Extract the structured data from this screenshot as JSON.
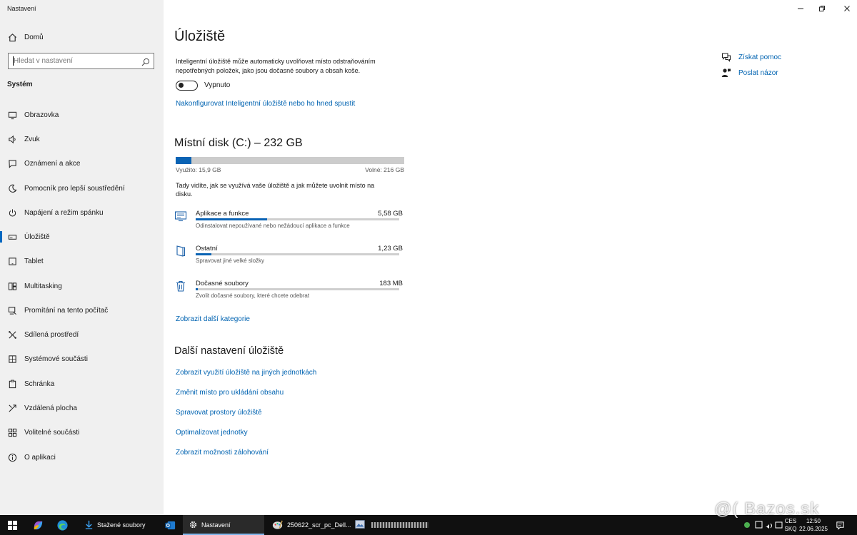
{
  "window": {
    "title": "Nastavení"
  },
  "sidebar": {
    "home_label": "Domů",
    "search_placeholder": "Hledat v nastavení",
    "section_label": "Systém",
    "items": [
      {
        "label": "Obrazovka",
        "icon": "monitor-icon"
      },
      {
        "label": "Zvuk",
        "icon": "speaker-icon"
      },
      {
        "label": "Oznámení a akce",
        "icon": "notification-icon"
      },
      {
        "label": "Pomocník pro lepší soustředění",
        "icon": "moon-icon"
      },
      {
        "label": "Napájení a režim spánku",
        "icon": "power-icon"
      },
      {
        "label": "Úložiště",
        "icon": "storage-icon",
        "selected": true
      },
      {
        "label": "Tablet",
        "icon": "tablet-icon"
      },
      {
        "label": "Multitasking",
        "icon": "multitasking-icon"
      },
      {
        "label": "Promítání na tento počítač",
        "icon": "projecting-icon"
      },
      {
        "label": "Sdílená prostředí",
        "icon": "shared-icon"
      },
      {
        "label": "Systémové součásti",
        "icon": "components-icon"
      },
      {
        "label": "Schránka",
        "icon": "clipboard-icon"
      },
      {
        "label": "Vzdálená plocha",
        "icon": "remote-icon"
      },
      {
        "label": "Volitelné součásti",
        "icon": "optional-icon"
      },
      {
        "label": "O aplikaci",
        "icon": "info-icon"
      }
    ]
  },
  "main": {
    "title": "Úložiště",
    "storage_sense_desc_line1": "Inteligentní úložiště může automaticky uvolňovat místo odstraňováním",
    "storage_sense_desc_line2": "nepotřebných položek, jako jsou dočasné soubory a obsah koše.",
    "toggle_label": "Vypnuto",
    "toggle_on": false,
    "configure_link": "Nakonfigurovat Inteligentní úložiště nebo ho hned spustit",
    "disk_title": "Místní disk (C:) – 232 GB",
    "disk_used_fraction": 0.0685,
    "used_label": "Využito: 15,9 GB",
    "free_label": "Volné: 216 GB",
    "usage_desc_line1": "Tady vidíte, jak se využívá vaše úložiště a jak můžete uvolnit místo na",
    "usage_desc_line2": "disku.",
    "categories": [
      {
        "name": "Aplikace a funkce",
        "size": "5,58 GB",
        "fraction": 0.35,
        "desc": "Odinstalovat nepoužívané nebo nežádoucí aplikace a funkce",
        "icon": "apps-icon"
      },
      {
        "name": "Ostatní",
        "size": "1,23 GB",
        "fraction": 0.077,
        "desc": "Spravovat jiné velké složky",
        "icon": "other-folder-icon"
      },
      {
        "name": "Dočasné soubory",
        "size": "183 MB",
        "fraction": 0.011,
        "desc": "Zvolit dočasné soubory, které chcete odebrat",
        "icon": "trash-icon"
      }
    ],
    "more_categories_link": "Zobrazit další kategorie",
    "more_settings_title": "Další nastavení úložiště",
    "more_links": [
      "Zobrazit využití úložiště na jiných jednotkách",
      "Změnit místo pro ukládání obsahu",
      "Spravovat prostory úložiště",
      "Optimalizovat jednotky",
      "Zobrazit možnosti zálohování"
    ],
    "help_link": "Získat pomoc",
    "feedback_link": "Poslat názor"
  },
  "taskbar": {
    "apps": [
      {
        "label": "Stažené soubory",
        "icon": "folder-download-icon"
      },
      {
        "label": "Nastavení",
        "icon": "gear-icon",
        "active": true
      },
      {
        "label": "250622_scr_pc_Dell...",
        "icon": "paint-icon"
      },
      {
        "label": "",
        "icon": "image-viewer-icon"
      }
    ],
    "lang_top": "CES",
    "lang_bottom": "SKQ",
    "time": "12:50",
    "date": "22.06.2025"
  },
  "watermark": "@( Bazos.sk",
  "colors": {
    "accent": "#0063b1",
    "bar_fill": "#0a63b4",
    "sidebar_bg": "#f0f0f0",
    "taskbar_bg": "#101010"
  }
}
